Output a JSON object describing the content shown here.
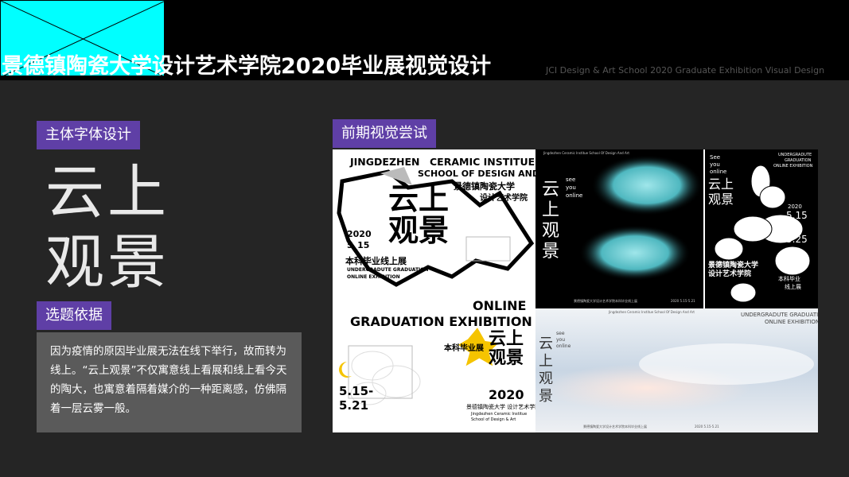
{
  "header": {
    "title_highlight": "景德镇陶瓷大学",
    "title_rest": "设计艺术学院2020毕业展视觉设计",
    "subtitle": "JCI Design & Art School 2020 Graduate Exhibition Visual Design"
  },
  "sections": {
    "font_design_tag": "主体字体设计",
    "visual_attempt_tag": "前期视觉尝试",
    "topic_basis_tag": "选题依据"
  },
  "font_design": {
    "chars": "云上观景"
  },
  "topic_basis": {
    "text": "因为疫情的原因毕业展无法在线下举行，故而转为线上。“云上观景”不仅寓意线上看展和线上看今天的陶大，也寓意着隔着媒介的一种距离感，仿佛隔着一层云雾一般。"
  },
  "posters": {
    "p1": {
      "line1": "JINGDEZHEN",
      "line1b": "CERAMIC INSTITUE",
      "line2": "SCHOOL OF DESIGN AND ART",
      "cn1": "景德镇陶瓷大学",
      "cn2": "设计艺术学院",
      "big": "云上观景",
      "date1": "2020",
      "date2": "5_15",
      "cn3": "本科毕业线上展",
      "en3a": "UNDERGRADUTE GRADUATION",
      "en3b": "ONLINE EXHIBITION"
    },
    "p2": {
      "head": "Jingdezhen Ceramic Institue  School Of Design And Art",
      "en_a": "see",
      "en_b": "you",
      "en_c": "online",
      "big": "云上观景",
      "foot": "景德镇陶瓷大学设计艺术学院本科毕业线上展",
      "date": "2020  5.15-5.21"
    },
    "p3": {
      "en_a": "See",
      "en_b": "you",
      "en_c": "online",
      "r1": "UNDERGRADUTE",
      "r2": "GRADUATION",
      "r3": "ONLINE EXHIBITION",
      "big": "云上观景",
      "y": "2020",
      "d1": "5.15",
      "d2": "5.25",
      "cn1": "景德镇陶瓷大学",
      "cn2": "设计艺术学院",
      "cn3": "本科毕业",
      "cn4": "线上展"
    },
    "p4": {
      "online": "ONLINE",
      "grad": "GRADUATION EXHIBITION",
      "star": "本科毕业展",
      "big": "云上观景",
      "year": "2020",
      "d1": "5.15-",
      "d2": "5.21",
      "cn1": "景德镇陶瓷大学  设计艺术学院",
      "en1": "Jingdezhen Ceramic Institue",
      "en2": "School of Design & Art"
    },
    "p5": {
      "head": "Jingdezhen Ceramic Institue  School Of Design And Art",
      "en_a": "see",
      "en_b": "you",
      "en_c": "online",
      "big": "云上观景",
      "r1": "UNDERGRADUTE GRADUATION",
      "r2": "ONLINE EXHIBITION",
      "foot": "景德镇陶瓷大学设计艺术学院本科毕业线上展",
      "date": "2020  5.15-5.21"
    }
  },
  "colors": {
    "accent": "#5f3fa6",
    "logo": "#00ffff",
    "background": "#252525"
  }
}
